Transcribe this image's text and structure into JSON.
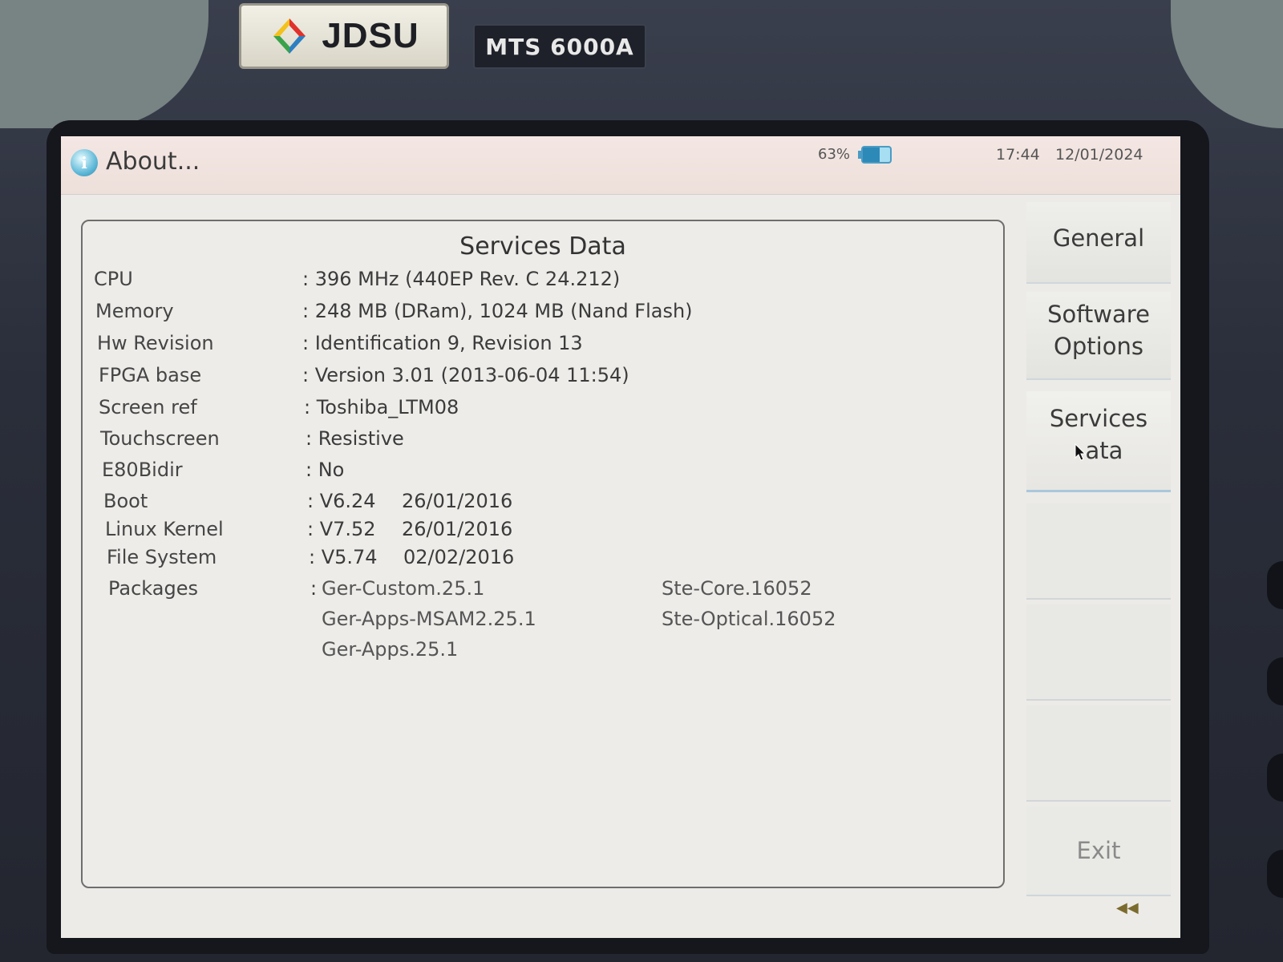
{
  "device": {
    "brand": "JDSU",
    "model": "MTS 6000A"
  },
  "titlebar": {
    "title": "About...",
    "battery_percent": "63%",
    "battery_level": 0.63,
    "time": "17:44",
    "date": "12/01/2024"
  },
  "panel": {
    "heading": "Services Data",
    "rows": [
      {
        "label": "CPU",
        "value": ": 396 MHz (440EP Rev. C 24.212)"
      },
      {
        "label": "Memory",
        "value": ": 248 MB (DRam), 1024 MB (Nand Flash)"
      },
      {
        "label": "Hw Revision",
        "value": ": Identification 9, Revision 13"
      },
      {
        "label": "FPGA base",
        "value": ": Version 3.01 (2013-06-04 11:54)"
      },
      {
        "label": "Screen ref",
        "value": ": Toshiba_LTM08"
      },
      {
        "label": "Touchscreen",
        "value": ": Resistive"
      },
      {
        "label": "E80Bidir",
        "value": ": No"
      }
    ],
    "versions": [
      {
        "label": "Boot",
        "version": ": V6.24",
        "date": "26/01/2016"
      },
      {
        "label": "Linux Kernel",
        "version": ": V7.52",
        "date": "26/01/2016"
      },
      {
        "label": "File System",
        "version": ": V5.74",
        "date": "02/02/2016"
      }
    ],
    "packages_label": "Packages",
    "packages_colon": ":",
    "packages_col1": [
      "Ger-Custom.25.1",
      "Ger-Apps-MSAM2.25.1",
      "Ger-Apps.25.1"
    ],
    "packages_col2": [
      "Ste-Core.16052",
      "Ste-Optical.16052"
    ]
  },
  "menu": {
    "general": "General",
    "software_options_1": "Software",
    "software_options_2": "Options",
    "services_data_1": "Services",
    "services_data_2": "ata",
    "exit": "Exit"
  },
  "icons": {
    "info": "info-icon",
    "battery": "battery-icon",
    "cursor": "cursor-icon",
    "rewind": "rewind-icon"
  }
}
